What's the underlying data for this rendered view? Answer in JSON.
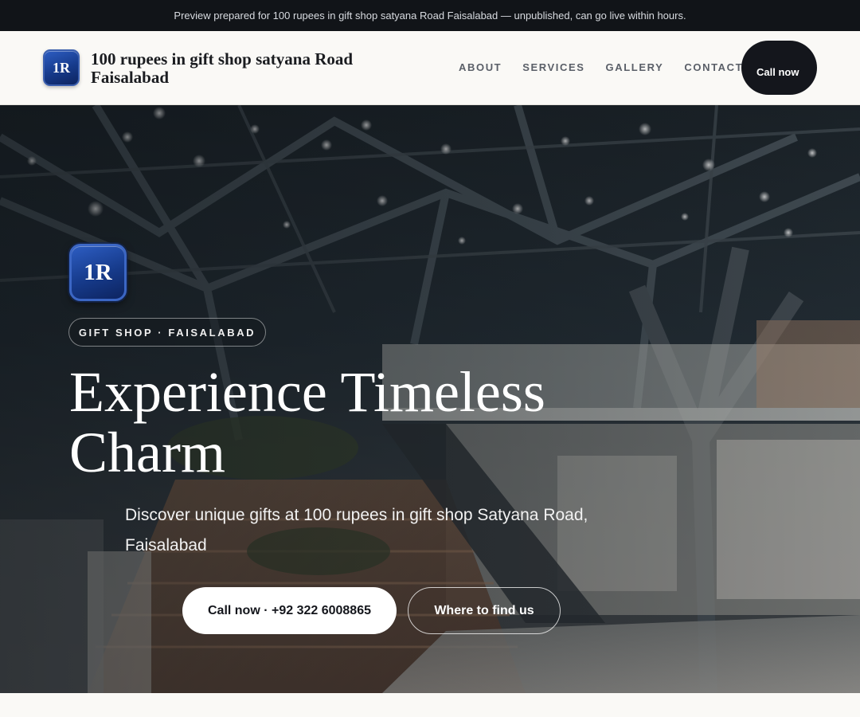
{
  "preview_banner": {
    "text": "Preview prepared for 100 rupees in gift shop satyana Road Faisalabad — unpublished, can go live within hours."
  },
  "header": {
    "logo_text": "1R",
    "brand_name": "100 rupees in gift shop satyana Road Faisalabad",
    "nav": [
      "ABOUT",
      "SERVICES",
      "GALLERY",
      "CONTACT"
    ],
    "call_label": "Call now"
  },
  "hero": {
    "logo_text": "1R",
    "tagline": "GIFT SHOP · FAISALABAD",
    "title": "Experience Timeless Charm",
    "subtitle": "Discover unique gifts at 100 rupees in gift shop Satyana Road, Faisalabad",
    "primary_button": "Call now · +92 322 6008865",
    "secondary_button": "Where to find us",
    "background_image": "mall-interior-photo"
  },
  "colors": {
    "banner_bg": "#111418",
    "header_bg": "#faf9f6",
    "brand_text": "#1a1c20",
    "call_button_bg": "#14161c",
    "logo_blue": "#163a8a"
  }
}
